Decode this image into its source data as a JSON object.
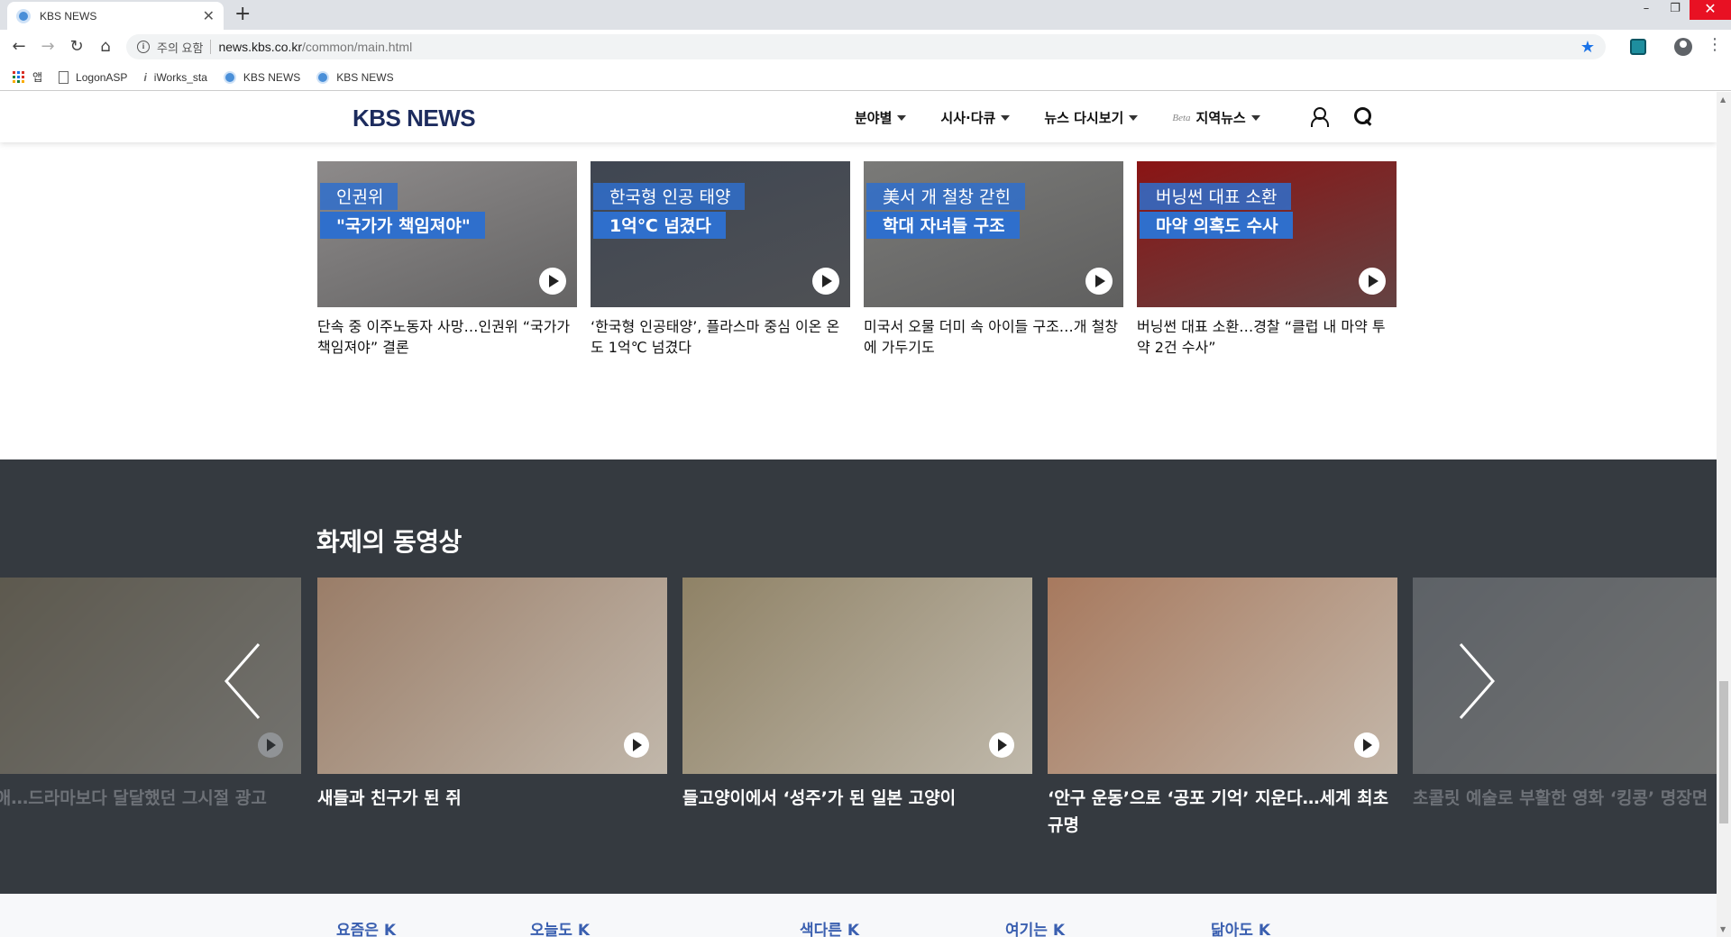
{
  "browser": {
    "tab_title": "KBS NEWS",
    "security_warning": "주의 요함",
    "url_host": "news.kbs.co.kr",
    "url_path": "/common/main.html",
    "bookmarks": [
      "앱",
      "LogonASP",
      "iWorks_sta",
      "KBS NEWS",
      "KBS NEWS"
    ]
  },
  "site": {
    "logo": "KBS NEWS",
    "nav": [
      "분야별",
      "시사·다큐",
      "뉴스 다시보기",
      "지역뉴스"
    ],
    "beta_label": "Beta"
  },
  "news": [
    {
      "cap1": "인권위",
      "cap2": "\"국가가 책임져야\"",
      "title": "단속 중 이주노동자 사망…인권위 “국가가 책임져야” 결론",
      "bg": "#8d8a8a"
    },
    {
      "cap1": "한국형 인공 태양",
      "cap2": "1억℃ 넘겼다",
      "title": "‘한국형 인공태양’, 플라스마 중심 이온 온도 1억℃ 넘겼다",
      "bg": "#3f4652"
    },
    {
      "cap1": "美서 개 철창 갇힌",
      "cap2": "학대 자녀들 구조",
      "title": "미국서 오물 더미 속 아이들 구조…개 철창에 가두기도",
      "bg": "#7a7a78"
    },
    {
      "cap1": "버닝썬 대표 소환",
      "cap2": "마약 의혹도 수사",
      "title": "버닝썬 대표 소환…경찰 “클럽 내 마약 투약 2건 수사”",
      "bg": "#8a1414"
    }
  ],
  "videos": {
    "heading": "화제의 동영상",
    "items": [
      {
        "title": "· 이영애…드라마보다 달달했던 그시절 광고",
        "bg": "#8a7a5a"
      },
      {
        "title": "새들과 친구가 된 쥐",
        "bg": "#9a7d68"
      },
      {
        "title": "들고양이에서 ‘성주’가 된 일본 고양이",
        "bg": "#8f8266"
      },
      {
        "title": "‘안구 운동’으로 ‘공포 기억’ 지운다…세계 최초 규명",
        "bg": "#a7795e"
      },
      {
        "title": "초콜릿 예술로 부활한 영화 ‘킹콩’ 명장면",
        "bg": "#8f9297"
      }
    ]
  },
  "bottom_links": [
    "요즘은 K",
    "오늘도 K",
    "색다른 K",
    "여기는 K",
    "닮아도 K"
  ]
}
